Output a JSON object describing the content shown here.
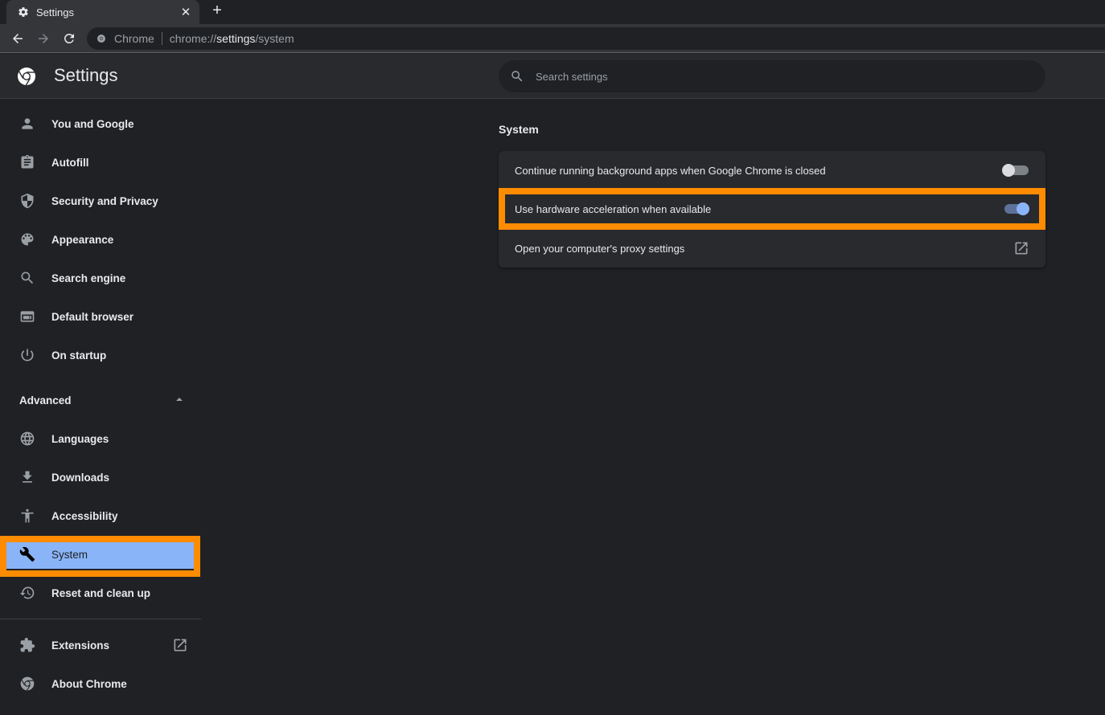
{
  "browser": {
    "tab": {
      "title": "Settings",
      "icon": "gear-icon",
      "close_icon": "close-icon"
    },
    "new_tab_icon": "plus-icon",
    "nav": {
      "back_icon": "arrow-back-icon",
      "forward_icon": "arrow-forward-icon",
      "reload_icon": "reload-icon"
    },
    "omnibox": {
      "site_name": "Chrome",
      "url_scheme": "chrome://",
      "url_host": "settings",
      "url_path": "/system"
    }
  },
  "header": {
    "title": "Settings",
    "search": {
      "placeholder": "Search settings",
      "value": ""
    }
  },
  "sidebar": {
    "items": [
      {
        "label": "You and Google",
        "icon": "person-icon"
      },
      {
        "label": "Autofill",
        "icon": "clipboard-icon"
      },
      {
        "label": "Security and Privacy",
        "icon": "shield-icon"
      },
      {
        "label": "Appearance",
        "icon": "palette-icon"
      },
      {
        "label": "Search engine",
        "icon": "search-icon"
      },
      {
        "label": "Default browser",
        "icon": "browser-window-icon"
      },
      {
        "label": "On startup",
        "icon": "power-icon"
      }
    ],
    "advanced": {
      "label": "Advanced",
      "expanded": true,
      "items": [
        {
          "label": "Languages",
          "icon": "globe-icon"
        },
        {
          "label": "Downloads",
          "icon": "download-icon"
        },
        {
          "label": "Accessibility",
          "icon": "accessibility-icon"
        },
        {
          "label": "System",
          "icon": "wrench-icon",
          "selected": true
        },
        {
          "label": "Reset and clean up",
          "icon": "restore-icon"
        }
      ]
    },
    "footer_items": [
      {
        "label": "Extensions",
        "icon": "puzzle-icon",
        "external": true
      },
      {
        "label": "About Chrome",
        "icon": "chrome-logo-icon"
      }
    ]
  },
  "main": {
    "section_title": "System",
    "rows": [
      {
        "label": "Continue running background apps when Google Chrome is closed",
        "control": "toggle",
        "checked": false
      },
      {
        "label": "Use hardware acceleration when available",
        "control": "toggle",
        "checked": true,
        "highlighted": true
      },
      {
        "label": "Open your computer's proxy settings",
        "control": "external-link"
      }
    ]
  },
  "colors": {
    "accent": "#8ab4f8",
    "highlight": "#ff8c00",
    "background": "#202124",
    "surface": "#292a2d"
  }
}
